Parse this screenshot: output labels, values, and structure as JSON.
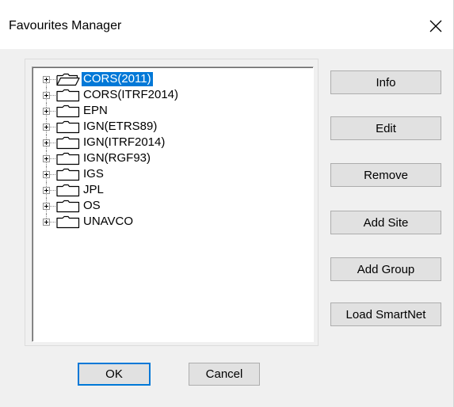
{
  "window": {
    "title": "Favourites Manager",
    "close_icon": "close-icon"
  },
  "tree": {
    "items": [
      {
        "label": "CORS(2011)",
        "selected": true,
        "open": true
      },
      {
        "label": "CORS(ITRF2014)",
        "selected": false,
        "open": false
      },
      {
        "label": "EPN",
        "selected": false,
        "open": false
      },
      {
        "label": "IGN(ETRS89)",
        "selected": false,
        "open": false
      },
      {
        "label": "IGN(ITRF2014)",
        "selected": false,
        "open": false
      },
      {
        "label": "IGN(RGF93)",
        "selected": false,
        "open": false
      },
      {
        "label": "IGS",
        "selected": false,
        "open": false
      },
      {
        "label": "JPL",
        "selected": false,
        "open": false
      },
      {
        "label": "OS",
        "selected": false,
        "open": false
      },
      {
        "label": "UNAVCO",
        "selected": false,
        "open": false
      }
    ]
  },
  "buttons": {
    "info": "Info",
    "edit": "Edit",
    "remove": "Remove",
    "add_site": "Add Site",
    "add_group": "Add Group",
    "load_smartnet": "Load SmartNet",
    "ok": "OK",
    "cancel": "Cancel"
  },
  "colors": {
    "selection": "#0078d7",
    "dialog_bg": "#f0f0f0",
    "button_bg": "#e1e1e1"
  }
}
